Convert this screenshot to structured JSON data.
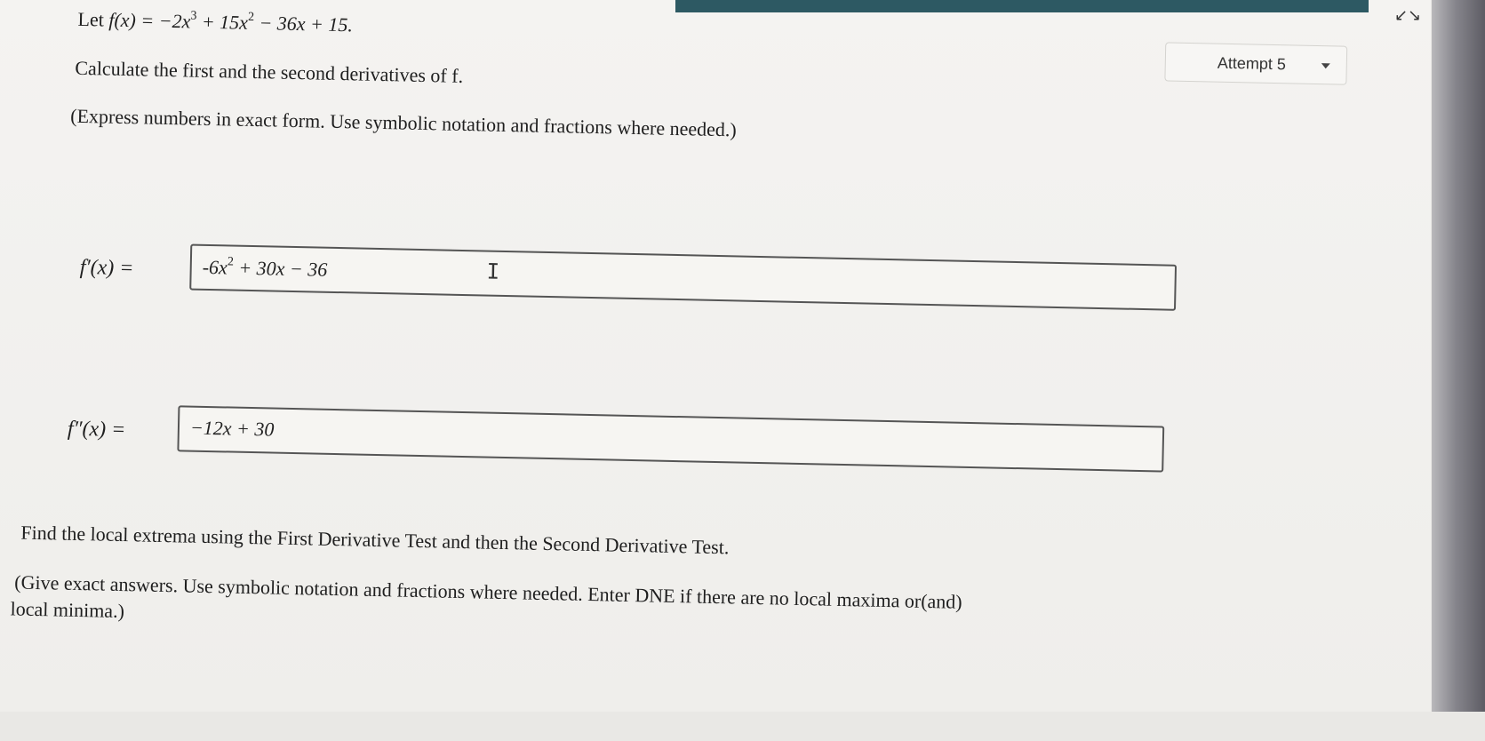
{
  "problem": {
    "function_lead": "Let",
    "function_def": "f(x) = −2x",
    "function_def_2": " + 15x",
    "function_def_3": " − 36x + 15.",
    "exp3": "3",
    "exp2": "2",
    "instruction": "Calculate the first and the second derivatives of f.",
    "format_note": "(Express numbers in exact form. Use symbolic notation and fractions where needed.)"
  },
  "attempt": {
    "label": "Attempt 5"
  },
  "first_derivative": {
    "label": "f′(x) =",
    "value_a": "-6x",
    "value_exp": "2",
    "value_b": " + 30x − 36"
  },
  "second_derivative": {
    "label": "f″(x) =",
    "value": "−12x + 30"
  },
  "extrema": {
    "instruction": "Find the local extrema using the First Derivative Test and then the Second Derivative Test.",
    "format_note_line1": "(Give exact answers. Use symbolic notation and fractions where needed. Enter DNE if there are no local maxima or(and)",
    "format_note_line2": "local minima.)"
  }
}
